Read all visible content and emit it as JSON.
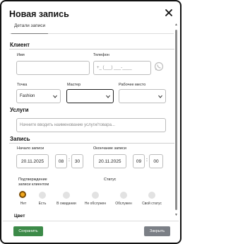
{
  "modal": {
    "title": "Новая запись"
  },
  "tabs": [
    {
      "label": "Детали записи"
    }
  ],
  "client": {
    "section_title": "Клиент",
    "name_label": "Имя",
    "name_value": "",
    "phone_label": "Телефон",
    "phone_mask": "+_ (___) ___-____"
  },
  "point": {
    "label": "Точка",
    "selected": "Fashion"
  },
  "master": {
    "label": "Мастер",
    "selected": ""
  },
  "workplace": {
    "label": "Рабочее место",
    "selected": ""
  },
  "services": {
    "section_title": "Услуги",
    "placeholder": "Начните вводить наименование услуги/товара..."
  },
  "booking": {
    "section_title": "Запись",
    "start_label": "Начало записи",
    "start_date": "20.11.2025",
    "start_hour": "08",
    "start_min": "30",
    "end_label": "Окончание записи",
    "end_date": "20.11.2025",
    "end_hour": "09",
    "end_min": "00"
  },
  "confirm": {
    "label_line1": "Подтверждение",
    "label_line2": "записи клиентом",
    "options": [
      "Нет",
      "Есть"
    ],
    "selected": "Нет"
  },
  "status": {
    "label": "Статус",
    "options": [
      "В ожидании",
      "Не обслужен",
      "Обслужен",
      "Свой статус"
    ]
  },
  "color": {
    "section_title": "Цвет"
  },
  "footer": {
    "save_label": "Сохранить",
    "close_label": "Закрыть"
  },
  "colors": {
    "accent_green": "#3c8a48",
    "radio_selected": "#f2a81d",
    "close_button": "#7b7f86"
  }
}
